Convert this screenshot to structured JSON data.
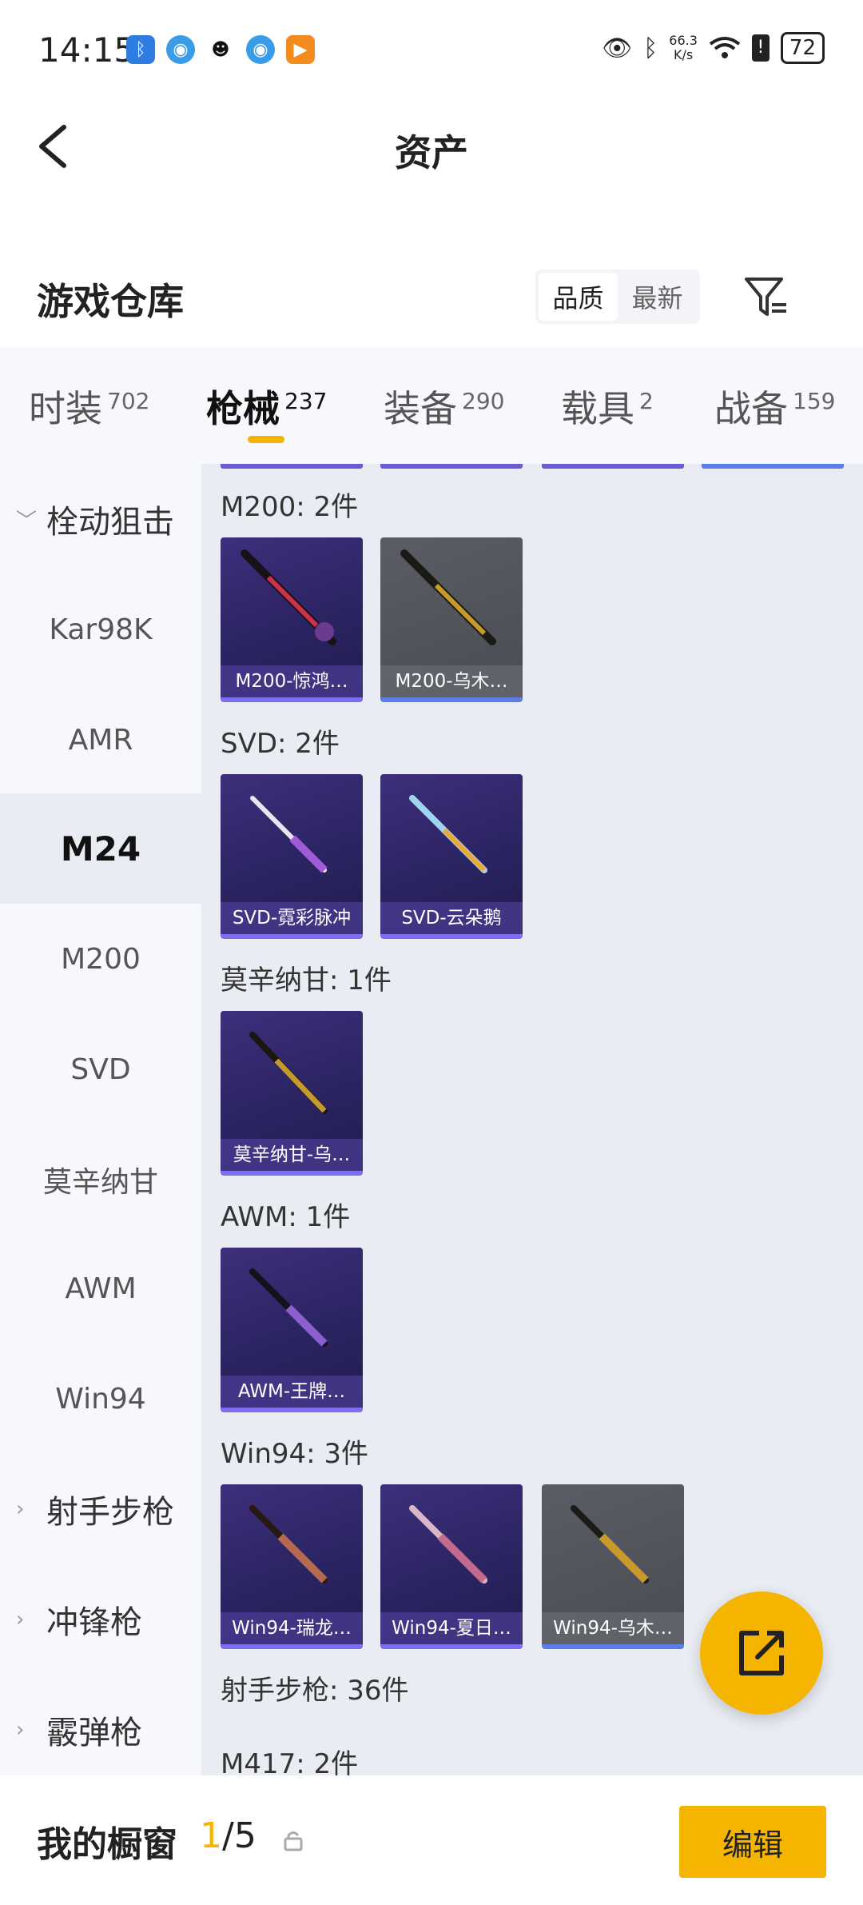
{
  "status_bar": {
    "time": "14:15",
    "net_speed_value": "66.3",
    "net_speed_unit": "K/s",
    "battery": "72"
  },
  "header": {
    "title": "资产"
  },
  "warehouse": {
    "title": "游戏仓库",
    "sort_options": [
      "品质",
      "最新"
    ]
  },
  "category_tabs": [
    {
      "label": "时装",
      "count": "702"
    },
    {
      "label": "枪械",
      "count": "237"
    },
    {
      "label": "装备",
      "count": "290"
    },
    {
      "label": "载具",
      "count": "2"
    },
    {
      "label": "战备",
      "count": "159"
    }
  ],
  "left_nav": [
    {
      "label": "栓动狙击"
    },
    {
      "label": "Kar98K"
    },
    {
      "label": "AMR"
    },
    {
      "label": "M24"
    },
    {
      "label": "M200"
    },
    {
      "label": "SVD"
    },
    {
      "label": "莫辛纳甘"
    },
    {
      "label": "AWM"
    },
    {
      "label": "Win94"
    },
    {
      "label": "射手步枪"
    },
    {
      "label": "冲锋枪"
    },
    {
      "label": "霰弹枪"
    }
  ],
  "sections": [
    {
      "title": "M200: 2件",
      "items": [
        "M200-惊鸿…",
        "M200-乌木…"
      ]
    },
    {
      "title": "SVD: 2件",
      "items": [
        "SVD-霓彩脉冲",
        "SVD-云朵鹅"
      ]
    },
    {
      "title": "莫辛纳甘: 1件",
      "items": [
        "莫辛纳甘-乌…"
      ]
    },
    {
      "title": "AWM: 1件",
      "items": [
        "AWM-王牌…"
      ]
    },
    {
      "title": "Win94: 3件",
      "items": [
        "Win94-瑞龙…",
        "Win94-夏日…",
        "Win94-乌木…"
      ]
    },
    {
      "title": "射手步枪: 36件",
      "items": []
    },
    {
      "title": "M417: 2件",
      "items": []
    }
  ],
  "showcase": {
    "label": "我的橱窗",
    "current": "1",
    "total": "/5",
    "edit_label": "编辑"
  },
  "colors": {
    "accent": "#f5b400",
    "purple_rarity": "#7b6cf0",
    "blue_rarity": "#5b7ee6"
  }
}
